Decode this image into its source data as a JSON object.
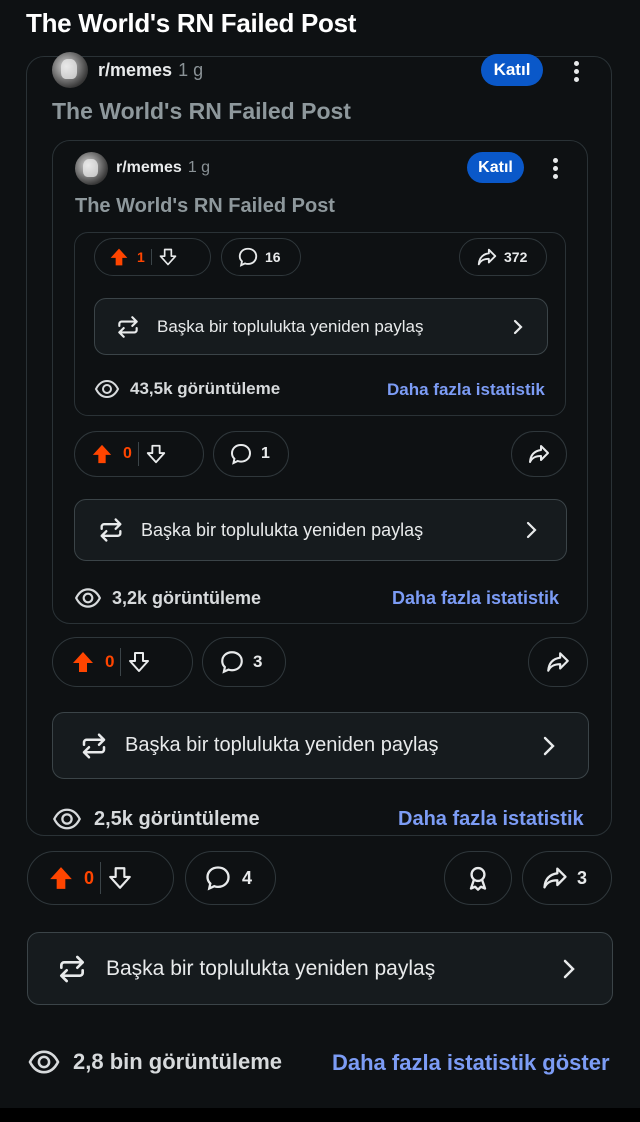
{
  "page": {
    "title": "The World's RN Failed Post"
  },
  "posts": [
    {
      "subreddit": "r/memes",
      "age": "1 g",
      "join_label": "Katıl",
      "title": "The World's RN Failed Post",
      "upvotes": "0",
      "comments": "3",
      "share_count": "",
      "repost_label": "Başka bir toplulukta yeniden paylaş",
      "views": "2,5k görüntüleme",
      "stats_label": "Daha fazla istatistik"
    },
    {
      "subreddit": "r/memes",
      "age": "1 g",
      "join_label": "Katıl",
      "title": "The World's RN Failed Post",
      "upvotes": "0",
      "comments": "1",
      "share_count": "",
      "repost_label": "Başka bir toplulukta yeniden paylaş",
      "views": "3,2k görüntüleme",
      "stats_label": "Daha fazla istatistik"
    },
    {
      "upvotes": "1",
      "comments": "16",
      "share_count": "372",
      "repost_label": "Başka bir toplulukta yeniden paylaş",
      "views": "43,5k görüntüleme",
      "stats_label": "Daha fazla istatistik"
    }
  ],
  "outer": {
    "upvotes": "0",
    "comments": "4",
    "share_count": "3",
    "repost_label": "Başka bir toplulukta yeniden paylaş",
    "views": "2,8 bin görüntüleme",
    "stats_label": "Daha fazla istatistik göster"
  },
  "colors": {
    "accent": "#0a58c9",
    "upvote": "#ff4500",
    "link": "#7c9cf5",
    "background": "#0e1113"
  },
  "icons": [
    "upvote-icon",
    "downvote-icon",
    "comment-icon",
    "share-icon",
    "repost-icon",
    "eye-icon",
    "award-icon",
    "more-icon",
    "chevron-right-icon"
  ]
}
